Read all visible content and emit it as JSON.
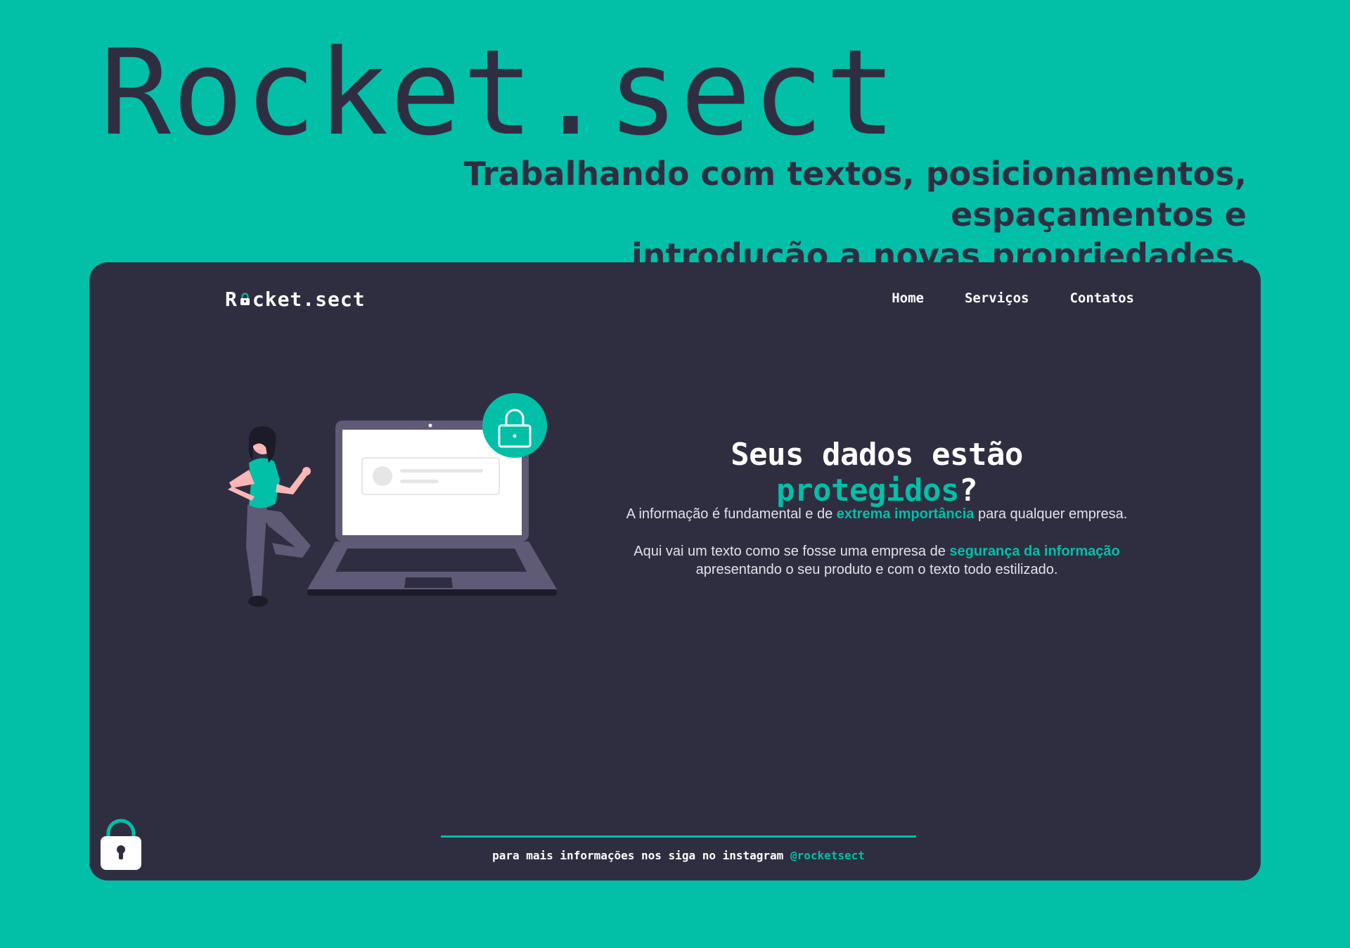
{
  "header": {
    "title": "Rocket.sect",
    "subtitle_line1": "Trabalhando com textos, posicionamentos, espaçamentos e",
    "subtitle_line2": "introdução a novas propriedades."
  },
  "site": {
    "logo_prefix": "R",
    "logo_suffix": "cket.sect",
    "nav": [
      "Home",
      "Serviços",
      "Contatos"
    ],
    "heading": {
      "part1": "Seus dados estão ",
      "highlight": "protegidos",
      "part2": "?"
    },
    "paragraph1": {
      "before": "A informação é fundamental e de ",
      "highlight": "extrema importância",
      "after": " para qualquer empresa."
    },
    "paragraph2": {
      "before": "Aqui vai um texto como se fosse uma empresa de ",
      "highlight": "segurança da informação",
      "after": " apresentando o seu produto e com o texto todo estilizado."
    },
    "footer": {
      "text": "para mais informações nos siga no instagram ",
      "handle": "@rocketsect"
    }
  },
  "colors": {
    "background": "#02bfa8",
    "card": "#2f2e41",
    "accent": "#02bfa8",
    "text_light": "#ffffff"
  },
  "icons": [
    "lock-icon",
    "padlock-badge-icon",
    "corner-lock-icon"
  ]
}
